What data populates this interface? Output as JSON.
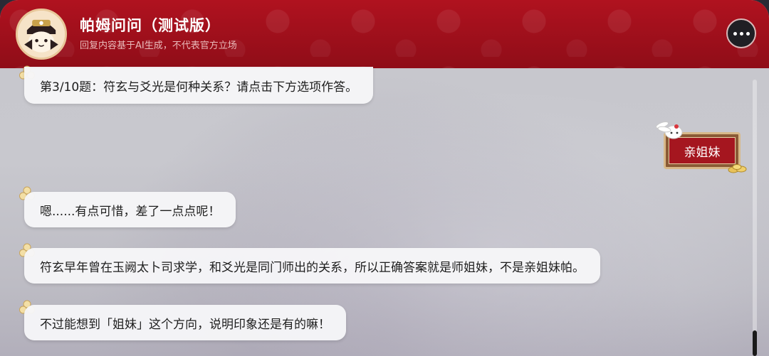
{
  "header": {
    "title": "帕姆问问（测试版）",
    "subtitle": "回复内容基于AI生成，不代表官方立场",
    "more_icon": "more-dots-icon",
    "accent_color": "#a5121e"
  },
  "messages": [
    {
      "role": "bot",
      "text": "第3/10题：符玄与爻光是何种关系？请点击下方选项作答。"
    },
    {
      "role": "user",
      "text": "亲姐妹"
    },
    {
      "role": "bot",
      "text": "嗯......有点可惜，差了一点点呢！"
    },
    {
      "role": "bot",
      "text": "符玄早年曾在玉阙太卜司求学，和爻光是同门师出的关系，所以正确答案就是师姐妹，不是亲姐妹帕。"
    },
    {
      "role": "bot",
      "text": "不过能想到「姐妹」这个方向，说明印象还是有的嘛！"
    }
  ]
}
